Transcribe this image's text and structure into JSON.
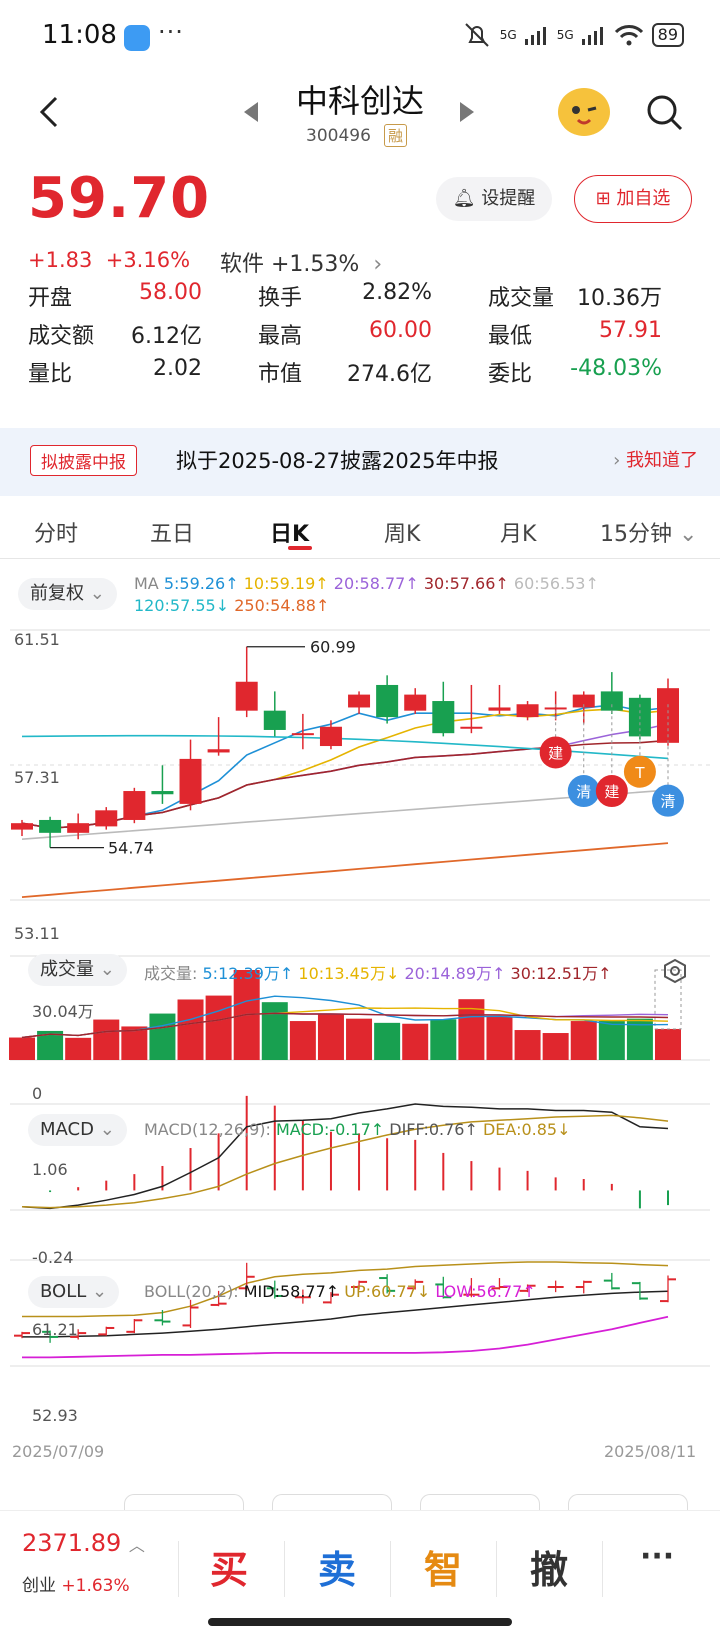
{
  "status_bar": {
    "time": "11:08",
    "dots": "···",
    "net1": "5G",
    "net2": "5G",
    "battery": "89"
  },
  "header": {
    "title": "中科创达",
    "code": "300496",
    "margin_tag": "融"
  },
  "quote": {
    "price": "59.70",
    "change": "+1.83",
    "change_pct": "+3.16%",
    "sector": "软件 +1.53%",
    "alert_label": "设提醒",
    "fav_label": "加自选",
    "stats": [
      {
        "k": "开盘",
        "v": "58.00",
        "color": "red"
      },
      {
        "k": "换手",
        "v": "2.82%",
        "color": "black"
      },
      {
        "k": "成交量",
        "v": "10.36万",
        "color": "black"
      },
      {
        "k": "成交额",
        "v": "6.12亿",
        "color": "black"
      },
      {
        "k": "最高",
        "v": "60.00",
        "color": "red"
      },
      {
        "k": "最低",
        "v": "57.91",
        "color": "red"
      },
      {
        "k": "量比",
        "v": "2.02",
        "color": "black"
      },
      {
        "k": "市值",
        "v": "274.6亿",
        "color": "black"
      },
      {
        "k": "委比",
        "v": "-48.03%",
        "color": "green"
      }
    ]
  },
  "notice": {
    "tag": "拟披露中报",
    "text": "拟于2025-08-27披露2025年中报",
    "action": "我知道了"
  },
  "tabs": [
    "分时",
    "五日",
    "日K",
    "周K",
    "月K",
    "15分钟"
  ],
  "kline": {
    "adjust_label": "前复权",
    "ma_title": "MA",
    "ma": [
      {
        "label": "5:59.26↑",
        "color": "#1e90d6"
      },
      {
        "label": "10:59.19↑",
        "color": "#e5b400"
      },
      {
        "label": "20:58.77↑",
        "color": "#9b63d9"
      },
      {
        "label": "30:57.66↑",
        "color": "#a0262c"
      },
      {
        "label": "60:56.53↑",
        "color": "#bbbbbb"
      },
      {
        "label": "120:57.55↓",
        "color": "#22b8c8"
      },
      {
        "label": "250:54.88↑",
        "color": "#e0682a"
      }
    ],
    "y_top": "61.51",
    "y_mid": "57.31",
    "y_bot": "53.11",
    "high_label": "60.99",
    "low_label": "54.74",
    "markers": [
      "建",
      "清",
      "建",
      "T",
      "清"
    ]
  },
  "volume": {
    "label": "成交量",
    "title": "成交量:",
    "ma": [
      {
        "label": "5:12.39万↑",
        "color": "#1e90d6"
      },
      {
        "label": "10:13.45万↓",
        "color": "#e5b400"
      },
      {
        "label": "20:14.89万↑",
        "color": "#9b63d9"
      },
      {
        "label": "30:12.51万↑",
        "color": "#a0262c"
      }
    ],
    "y_top": "30.04万",
    "y_zero": "0"
  },
  "macd": {
    "label": "MACD",
    "params": "MACD(12,26,9):",
    "macd": "MACD:-0.17↑",
    "diff": "DIFF:0.76↑",
    "dea": "DEA:0.85↓",
    "y_top": "1.06",
    "y_bot": "-0.24"
  },
  "boll": {
    "label": "BOLL",
    "params": "BOLL(20,2):",
    "mid": "MID:58.77↑",
    "up": "UP:60.77↓",
    "low": "LOW:56.77↑",
    "y_top": "61.21",
    "y_bot": "52.93"
  },
  "dates": {
    "start": "2025/07/09",
    "end": "2025/08/11"
  },
  "bottom": {
    "index_value": "2371.89",
    "index_name": "创业",
    "index_change": "+1.63%",
    "buy": "买",
    "sell": "卖",
    "smart": "智",
    "cancel": "撤",
    "more": "···"
  },
  "chart_data": {
    "type": "candlestick",
    "dates_range": [
      "2025/07/09",
      "2025/08/11"
    ],
    "ylim": [
      53.11,
      61.51
    ],
    "candles": [
      {
        "o": 55.3,
        "c": 55.5,
        "h": 55.6,
        "l": 55.1
      },
      {
        "o": 55.6,
        "c": 55.2,
        "h": 55.7,
        "l": 54.74
      },
      {
        "o": 55.2,
        "c": 55.5,
        "h": 55.8,
        "l": 55.0
      },
      {
        "o": 55.4,
        "c": 55.9,
        "h": 56.0,
        "l": 55.3
      },
      {
        "o": 55.6,
        "c": 56.5,
        "h": 56.6,
        "l": 55.5
      },
      {
        "o": 56.5,
        "c": 56.4,
        "h": 57.3,
        "l": 56.1
      },
      {
        "o": 56.1,
        "c": 57.5,
        "h": 58.1,
        "l": 55.9
      },
      {
        "o": 57.7,
        "c": 57.8,
        "h": 58.8,
        "l": 57.6
      },
      {
        "o": 59.0,
        "c": 59.9,
        "h": 60.99,
        "l": 58.8
      },
      {
        "o": 59.0,
        "c": 58.4,
        "h": 59.6,
        "l": 58.2
      },
      {
        "o": 58.3,
        "c": 58.3,
        "h": 58.9,
        "l": 57.8
      },
      {
        "o": 57.9,
        "c": 58.5,
        "h": 58.7,
        "l": 57.8
      },
      {
        "o": 59.1,
        "c": 59.5,
        "h": 59.6,
        "l": 58.9
      },
      {
        "o": 59.8,
        "c": 58.8,
        "h": 60.1,
        "l": 58.6
      },
      {
        "o": 59.0,
        "c": 59.5,
        "h": 59.7,
        "l": 58.9
      },
      {
        "o": 59.3,
        "c": 58.3,
        "h": 59.9,
        "l": 58.2
      },
      {
        "o": 58.5,
        "c": 58.5,
        "h": 59.8,
        "l": 58.3
      },
      {
        "o": 59.0,
        "c": 59.1,
        "h": 59.8,
        "l": 58.9
      },
      {
        "o": 58.8,
        "c": 59.2,
        "h": 59.3,
        "l": 58.7
      },
      {
        "o": 59.1,
        "c": 59.1,
        "h": 59.6,
        "l": 58.7
      },
      {
        "o": 59.1,
        "c": 59.5,
        "h": 59.6,
        "l": 58.6
      },
      {
        "o": 59.6,
        "c": 59.0,
        "h": 60.2,
        "l": 58.9
      },
      {
        "o": 59.4,
        "c": 58.2,
        "h": 59.5,
        "l": 58.1
      },
      {
        "o": 58.0,
        "c": 59.7,
        "h": 60.0,
        "l": 57.91
      }
    ],
    "volume": [
      7.5,
      9.7,
      7.4,
      13.5,
      11.2,
      15.5,
      20.2,
      21.5,
      30.04,
      19.3,
      13.0,
      15.5,
      13.8,
      12.4,
      12.1,
      13.6,
      20.3,
      14.5,
      10.0,
      9.0,
      13.0,
      13.0,
      13.8,
      10.36
    ],
    "macd_diff": [
      -0.2,
      -0.22,
      -0.18,
      -0.12,
      -0.05,
      0.05,
      0.22,
      0.4,
      0.78,
      0.85,
      0.86,
      0.88,
      0.95,
      1.0,
      1.06,
      1.03,
      1.02,
      1.0,
      1.0,
      0.98,
      0.98,
      0.96,
      0.78,
      0.76
    ],
    "macd_dea": [
      -0.2,
      -0.21,
      -0.2,
      -0.18,
      -0.15,
      -0.1,
      -0.04,
      0.05,
      0.2,
      0.33,
      0.43,
      0.52,
      0.6,
      0.68,
      0.75,
      0.8,
      0.84,
      0.86,
      0.88,
      0.9,
      0.91,
      0.92,
      0.89,
      0.85
    ],
    "boll_mid": [
      55.2,
      55.2,
      55.25,
      55.3,
      55.4,
      55.5,
      55.65,
      55.8,
      56.0,
      56.2,
      56.4,
      56.6,
      56.9,
      57.1,
      57.3,
      57.5,
      57.7,
      57.9,
      58.1,
      58.3,
      58.45,
      58.6,
      58.7,
      58.77
    ],
    "boll_up": [
      56.8,
      56.8,
      56.8,
      56.85,
      56.9,
      57.1,
      57.6,
      58.4,
      59.4,
      59.9,
      60.1,
      60.2,
      60.4,
      60.5,
      60.7,
      60.8,
      60.9,
      61.0,
      61.05,
      61.05,
      61.0,
      60.95,
      60.85,
      60.77
    ],
    "boll_low": [
      53.6,
      53.6,
      53.65,
      53.7,
      53.75,
      53.8,
      53.8,
      53.85,
      53.9,
      53.95,
      53.95,
      53.95,
      53.95,
      53.95,
      53.95,
      54.0,
      54.1,
      54.3,
      54.6,
      55.0,
      55.4,
      55.8,
      56.3,
      56.77
    ]
  }
}
